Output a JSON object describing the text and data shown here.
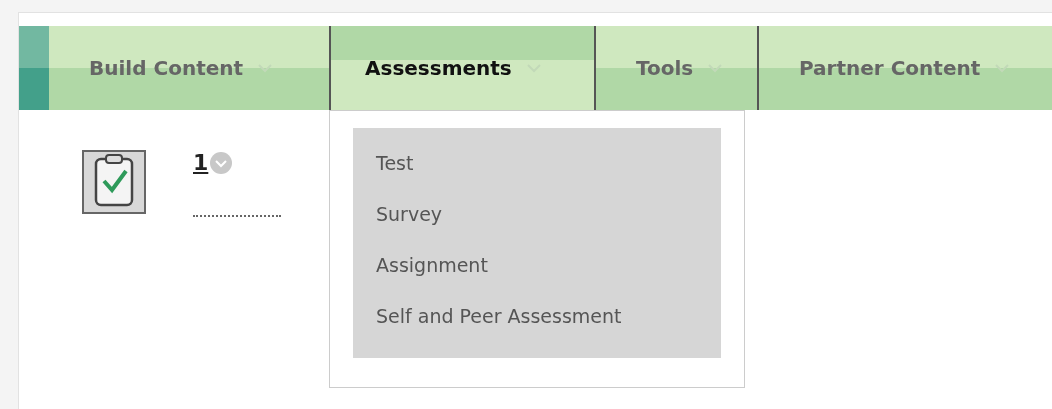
{
  "tabs": [
    {
      "label": "Build Content",
      "selected": false
    },
    {
      "label": "Assessments",
      "selected": true
    },
    {
      "label": "Tools",
      "selected": false
    },
    {
      "label": "Partner Content",
      "selected": false
    }
  ],
  "menu": {
    "items": [
      "Test",
      "Survey",
      "Assignment",
      "Self and Peer Assessment"
    ]
  },
  "content_item": {
    "title": "1"
  }
}
